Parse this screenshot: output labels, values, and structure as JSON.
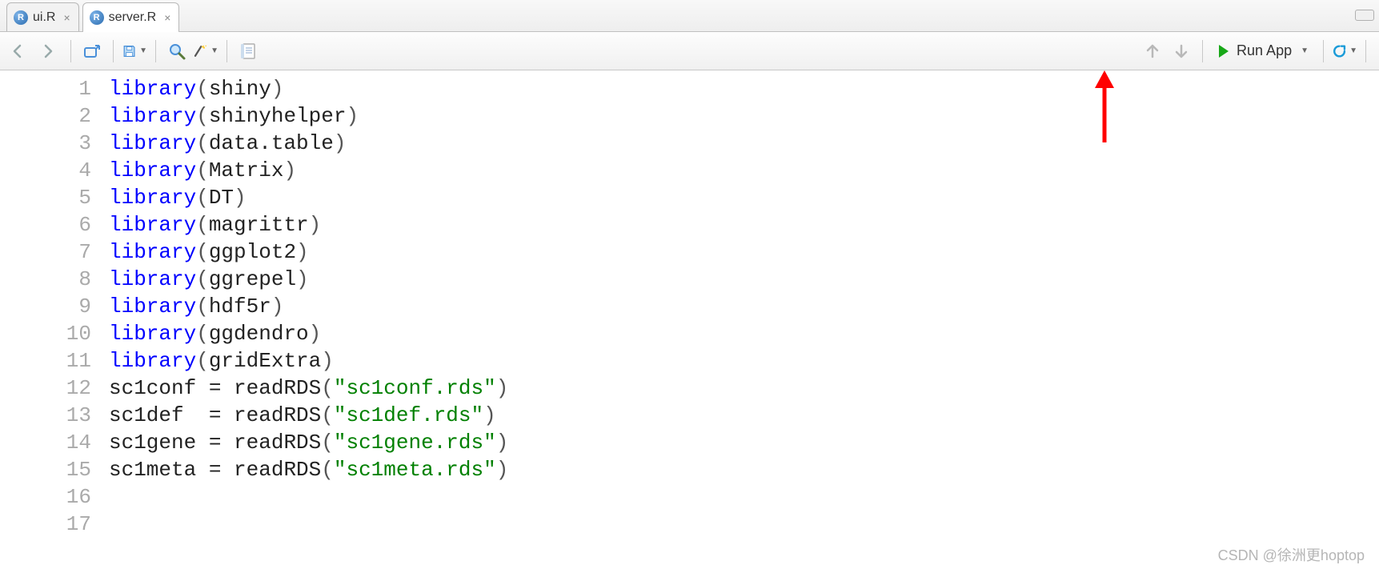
{
  "tabs": [
    {
      "label": "ui.R",
      "active": false
    },
    {
      "label": "server.R",
      "active": true
    }
  ],
  "toolbar": {
    "run_label": "Run App"
  },
  "code_lines": [
    [
      {
        "t": "keyword",
        "v": "library"
      },
      {
        "t": "paren",
        "v": "("
      },
      {
        "t": "ident",
        "v": "shiny"
      },
      {
        "t": "paren",
        "v": ")"
      }
    ],
    [
      {
        "t": "keyword",
        "v": "library"
      },
      {
        "t": "paren",
        "v": "("
      },
      {
        "t": "ident",
        "v": "shinyhelper"
      },
      {
        "t": "paren",
        "v": ")"
      }
    ],
    [
      {
        "t": "keyword",
        "v": "library"
      },
      {
        "t": "paren",
        "v": "("
      },
      {
        "t": "ident",
        "v": "data.table"
      },
      {
        "t": "paren",
        "v": ")"
      }
    ],
    [
      {
        "t": "keyword",
        "v": "library"
      },
      {
        "t": "paren",
        "v": "("
      },
      {
        "t": "ident",
        "v": "Matrix"
      },
      {
        "t": "paren",
        "v": ")"
      }
    ],
    [
      {
        "t": "keyword",
        "v": "library"
      },
      {
        "t": "paren",
        "v": "("
      },
      {
        "t": "ident",
        "v": "DT"
      },
      {
        "t": "paren",
        "v": ")"
      }
    ],
    [
      {
        "t": "keyword",
        "v": "library"
      },
      {
        "t": "paren",
        "v": "("
      },
      {
        "t": "ident",
        "v": "magrittr"
      },
      {
        "t": "paren",
        "v": ")"
      }
    ],
    [
      {
        "t": "keyword",
        "v": "library"
      },
      {
        "t": "paren",
        "v": "("
      },
      {
        "t": "ident",
        "v": "ggplot2"
      },
      {
        "t": "paren",
        "v": ")"
      }
    ],
    [
      {
        "t": "keyword",
        "v": "library"
      },
      {
        "t": "paren",
        "v": "("
      },
      {
        "t": "ident",
        "v": "ggrepel"
      },
      {
        "t": "paren",
        "v": ")"
      }
    ],
    [
      {
        "t": "keyword",
        "v": "library"
      },
      {
        "t": "paren",
        "v": "("
      },
      {
        "t": "ident",
        "v": "hdf5r"
      },
      {
        "t": "paren",
        "v": ")"
      }
    ],
    [
      {
        "t": "keyword",
        "v": "library"
      },
      {
        "t": "paren",
        "v": "("
      },
      {
        "t": "ident",
        "v": "ggdendro"
      },
      {
        "t": "paren",
        "v": ")"
      }
    ],
    [
      {
        "t": "keyword",
        "v": "library"
      },
      {
        "t": "paren",
        "v": "("
      },
      {
        "t": "ident",
        "v": "gridExtra"
      },
      {
        "t": "paren",
        "v": ")"
      }
    ],
    [
      {
        "t": "ident",
        "v": "sc1conf "
      },
      {
        "t": "op",
        "v": "="
      },
      {
        "t": "ident",
        "v": " readRDS"
      },
      {
        "t": "paren",
        "v": "("
      },
      {
        "t": "string",
        "v": "\"sc1conf.rds\""
      },
      {
        "t": "paren",
        "v": ")"
      }
    ],
    [
      {
        "t": "ident",
        "v": "sc1def  "
      },
      {
        "t": "op",
        "v": "="
      },
      {
        "t": "ident",
        "v": " readRDS"
      },
      {
        "t": "paren",
        "v": "("
      },
      {
        "t": "string",
        "v": "\"sc1def.rds\""
      },
      {
        "t": "paren",
        "v": ")"
      }
    ],
    [
      {
        "t": "ident",
        "v": "sc1gene "
      },
      {
        "t": "op",
        "v": "="
      },
      {
        "t": "ident",
        "v": " readRDS"
      },
      {
        "t": "paren",
        "v": "("
      },
      {
        "t": "string",
        "v": "\"sc1gene.rds\""
      },
      {
        "t": "paren",
        "v": ")"
      }
    ],
    [
      {
        "t": "ident",
        "v": "sc1meta "
      },
      {
        "t": "op",
        "v": "="
      },
      {
        "t": "ident",
        "v": " readRDS"
      },
      {
        "t": "paren",
        "v": "("
      },
      {
        "t": "string",
        "v": "\"sc1meta.rds\""
      },
      {
        "t": "paren",
        "v": ")"
      }
    ],
    [],
    []
  ],
  "watermark": "CSDN @徐洲更hoptop"
}
